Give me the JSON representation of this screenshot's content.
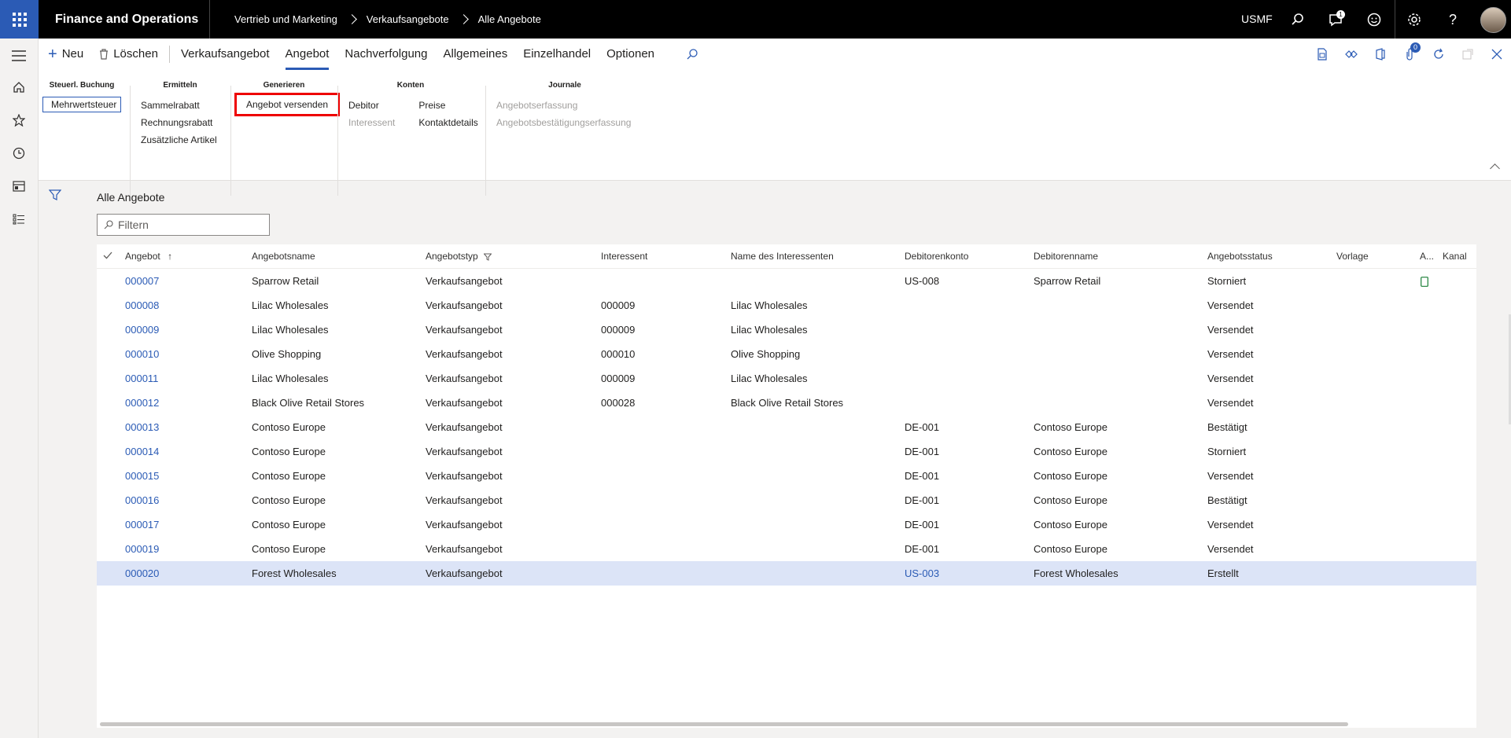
{
  "app": {
    "title": "Finance and Operations",
    "company": "USMF",
    "notification_count": "1"
  },
  "breadcrumb": [
    "Vertrieb und Marketing",
    "Verkaufsangebote",
    "Alle Angebote"
  ],
  "toolbar": {
    "new_label": "Neu",
    "delete_label": "Löschen",
    "tabs": [
      "Verkaufsangebot",
      "Angebot",
      "Nachverfolgung",
      "Allgemeines",
      "Einzelhandel",
      "Optionen"
    ],
    "active_tab": "Angebot",
    "attachments_badge": "0"
  },
  "ribbon": {
    "groups": {
      "steuer": {
        "title": "Steuerl. Buchung",
        "buttons": [
          "Mehrwertsteuer"
        ]
      },
      "ermitteln": {
        "title": "Ermitteln",
        "buttons": [
          "Sammelrabatt",
          "Rechnungsrabatt",
          "Zusätzliche Artikel"
        ]
      },
      "generieren": {
        "title": "Generieren",
        "buttons": [
          "Angebot versenden"
        ]
      },
      "konten": {
        "title": "Konten",
        "buttons": [
          "Debitor",
          "Interessent",
          "Preise",
          "Kontaktdetails"
        ]
      },
      "journale": {
        "title": "Journale",
        "buttons": [
          "Angebotserfassung",
          "Angebotsbestätigungserfassung"
        ]
      }
    }
  },
  "grid": {
    "title": "Alle Angebote",
    "filter_placeholder": "Filtern",
    "columns": [
      "Angebot",
      "Angebotsname",
      "Angebotstyp",
      "Interessent",
      "Name des Interessenten",
      "Debitorenkonto",
      "Debitorenname",
      "Angebotsstatus",
      "Vorlage",
      "A...",
      "Kanal"
    ],
    "sort_indicator": "↑",
    "rows": [
      {
        "id": "000007",
        "name": "Sparrow Retail",
        "type": "Verkaufsangebot",
        "prospect": "",
        "prospect_name": "",
        "account": "US-008",
        "customer": "Sparrow Retail",
        "status": "Storniert"
      },
      {
        "id": "000008",
        "name": "Lilac Wholesales",
        "type": "Verkaufsangebot",
        "prospect": "000009",
        "prospect_name": "Lilac Wholesales",
        "account": "",
        "customer": "",
        "status": "Versendet"
      },
      {
        "id": "000009",
        "name": "Lilac Wholesales",
        "type": "Verkaufsangebot",
        "prospect": "000009",
        "prospect_name": "Lilac Wholesales",
        "account": "",
        "customer": "",
        "status": "Versendet"
      },
      {
        "id": "000010",
        "name": "Olive Shopping",
        "type": "Verkaufsangebot",
        "prospect": "000010",
        "prospect_name": "Olive Shopping",
        "account": "",
        "customer": "",
        "status": "Versendet"
      },
      {
        "id": "000011",
        "name": "Lilac Wholesales",
        "type": "Verkaufsangebot",
        "prospect": "000009",
        "prospect_name": "Lilac Wholesales",
        "account": "",
        "customer": "",
        "status": "Versendet"
      },
      {
        "id": "000012",
        "name": "Black Olive Retail Stores",
        "type": "Verkaufsangebot",
        "prospect": "000028",
        "prospect_name": "Black Olive Retail Stores",
        "account": "",
        "customer": "",
        "status": "Versendet"
      },
      {
        "id": "000013",
        "name": "Contoso Europe",
        "type": "Verkaufsangebot",
        "prospect": "",
        "prospect_name": "",
        "account": "DE-001",
        "customer": "Contoso Europe",
        "status": "Bestätigt"
      },
      {
        "id": "000014",
        "name": "Contoso Europe",
        "type": "Verkaufsangebot",
        "prospect": "",
        "prospect_name": "",
        "account": "DE-001",
        "customer": "Contoso Europe",
        "status": "Storniert"
      },
      {
        "id": "000015",
        "name": "Contoso Europe",
        "type": "Verkaufsangebot",
        "prospect": "",
        "prospect_name": "",
        "account": "DE-001",
        "customer": "Contoso Europe",
        "status": "Versendet"
      },
      {
        "id": "000016",
        "name": "Contoso Europe",
        "type": "Verkaufsangebot",
        "prospect": "",
        "prospect_name": "",
        "account": "DE-001",
        "customer": "Contoso Europe",
        "status": "Bestätigt"
      },
      {
        "id": "000017",
        "name": "Contoso Europe",
        "type": "Verkaufsangebot",
        "prospect": "",
        "prospect_name": "",
        "account": "DE-001",
        "customer": "Contoso Europe",
        "status": "Versendet"
      },
      {
        "id": "000019",
        "name": "Contoso Europe",
        "type": "Verkaufsangebot",
        "prospect": "",
        "prospect_name": "",
        "account": "DE-001",
        "customer": "Contoso Europe",
        "status": "Versendet"
      },
      {
        "id": "000020",
        "name": "Forest Wholesales",
        "type": "Verkaufsangebot",
        "prospect": "",
        "prospect_name": "",
        "account": "US-003",
        "customer": "Forest Wholesales",
        "status": "Erstellt",
        "selected": true
      }
    ]
  },
  "colors": {
    "accent": "#2b5bb5",
    "topbar": "#000000",
    "selected_row": "#dce4f7",
    "highlight_box": "#e00000"
  }
}
